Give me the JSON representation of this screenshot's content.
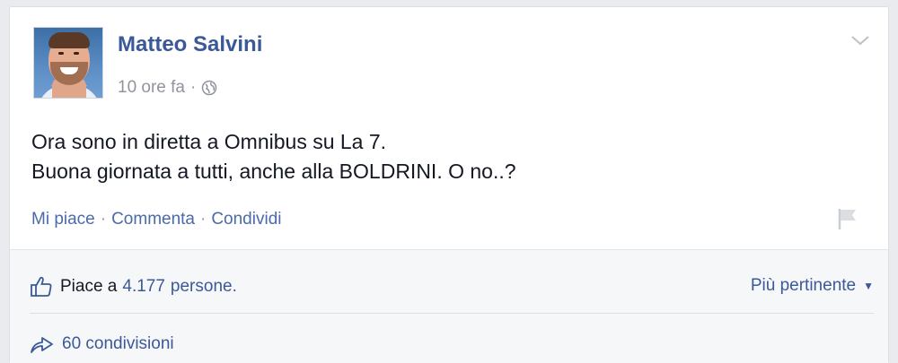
{
  "post": {
    "author": "Matteo Salvini",
    "time": "10 ore fa",
    "meta_separator": "·",
    "text_line_1": "Ora sono in diretta a Omnibus su La 7.",
    "text_line_2": "Buona giornata a tutti, anche alla BOLDRINI. O no..?"
  },
  "actions": {
    "like": "Mi piace",
    "comment": "Commenta",
    "share": "Condividi",
    "separator": "·"
  },
  "footer": {
    "likes_prefix": "Piace a",
    "likes_count": "4.177",
    "likes_suffix": "persone.",
    "sort_label": "Più pertinente",
    "shares": "60 condivisioni"
  },
  "icons": {
    "avatar": "profile-photo",
    "privacy": "globe-icon",
    "menu": "chevron-down-icon",
    "report": "flag-icon",
    "like": "thumbs-up-icon",
    "share": "share-arrow-icon",
    "sort": "caret-down-icon"
  },
  "colors": {
    "link": "#3b5998",
    "secondary_text": "#90949c",
    "footer_bg": "#f6f7f9"
  }
}
